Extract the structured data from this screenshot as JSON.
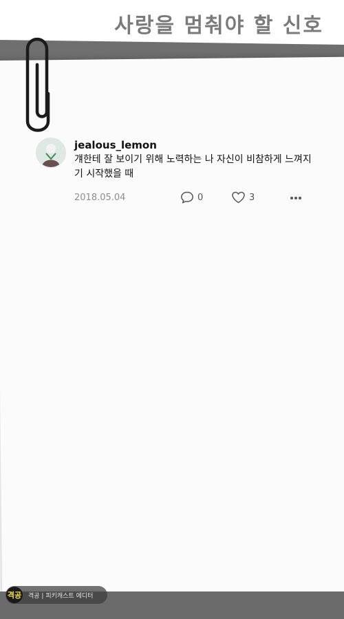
{
  "header": {
    "title": "사랑을 멈춰야 할 신호"
  },
  "post": {
    "username": "jealous_lemon",
    "text": "걔한테 잘 보이기 위해 노력하는 나 자신이 비참하게 느껴지기 시작했을 때",
    "date": "2018.05.04",
    "comment_count": "0",
    "like_count": "3"
  },
  "watermark": {
    "logo": "격공",
    "text": "격공 | 피키캐스트 에디터"
  },
  "colors": {
    "band": "#6f6f6f",
    "paper": "#fbfbfb",
    "logo_text": "#f5e042"
  },
  "icons": [
    "paperclip-icon",
    "comment-icon",
    "heart-icon",
    "more-icon"
  ]
}
